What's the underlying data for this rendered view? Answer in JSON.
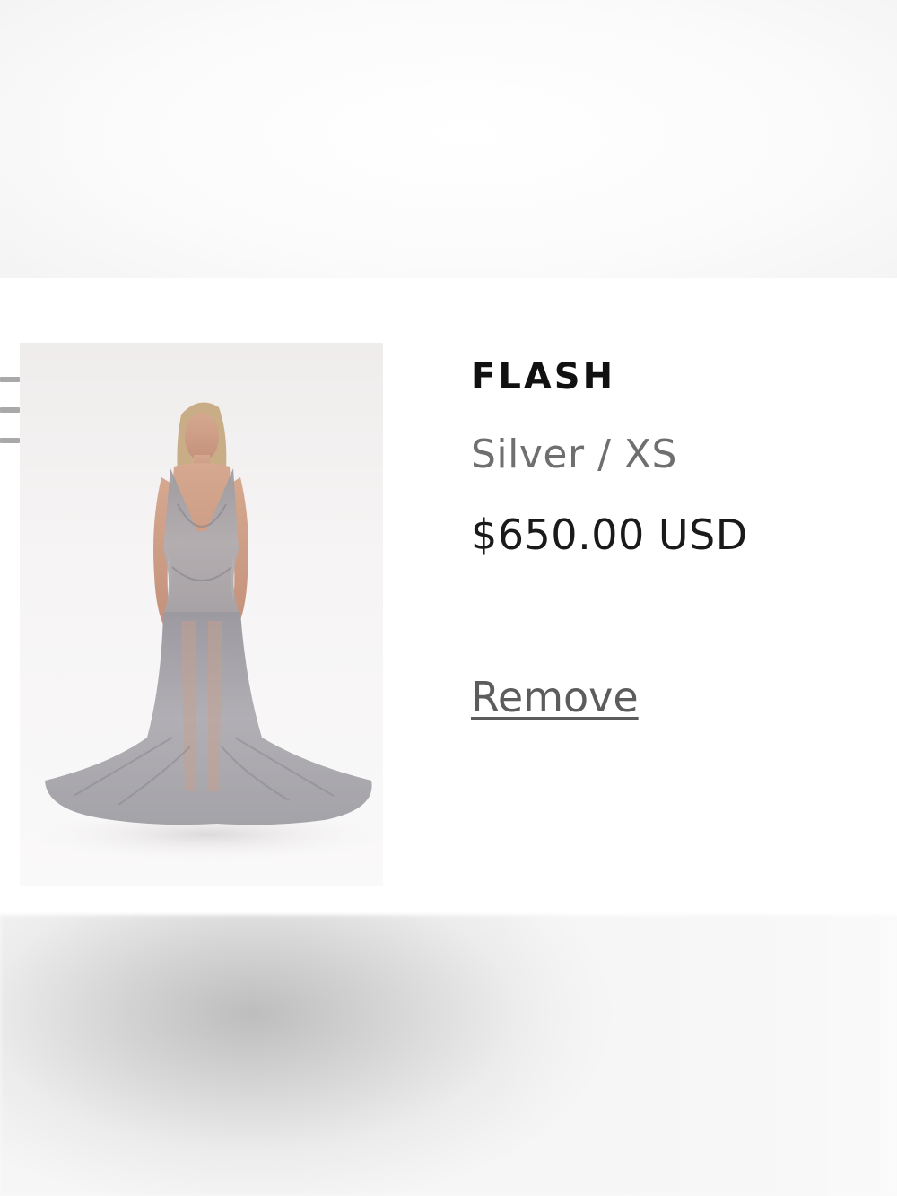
{
  "cart_item": {
    "title": "FLASH",
    "variant": "Silver / XS",
    "price": "$650.00 USD",
    "remove_label": "Remove",
    "image_icon": "product-photo-silver-gown"
  },
  "colors": {
    "title": "#111111",
    "variant": "#6f6f6f",
    "price": "#1a1a1a",
    "remove": "#5c5c5c",
    "gown": "#a7a7ab"
  },
  "icons": {
    "side_menu": "menu-icon"
  }
}
